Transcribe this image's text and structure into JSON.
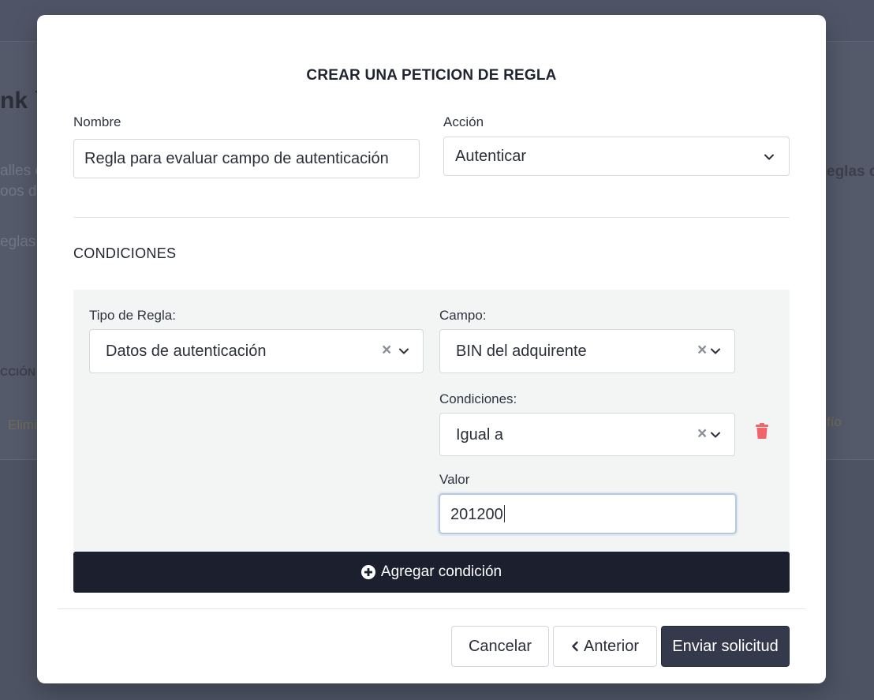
{
  "background": {
    "heading_fragment": "nk `",
    "text_lines": [
      "alles c",
      "oos d",
      "eglas"
    ],
    "table_header": "CCIÓN",
    "delete_link": "Elimi",
    "right_bold": "eglas c",
    "right_link": "fío"
  },
  "modal": {
    "title": "CREAR UNA PETICION DE REGLA",
    "nombre": {
      "label": "Nombre",
      "value": "Regla para evaluar campo de autenticación"
    },
    "accion": {
      "label": "Acción",
      "value": "Autenticar"
    },
    "conditions_section": {
      "title": "CONDICIONES",
      "tipo_regla": {
        "label": "Tipo de Regla:",
        "value": "Datos de autenticación"
      },
      "campo": {
        "label": "Campo:",
        "value": "BIN del adquirente"
      },
      "condiciones": {
        "label": "Condiciones:",
        "value": "Igual a"
      },
      "valor": {
        "label": "Valor",
        "value": "201200"
      },
      "add_button_label": "Agregar condición"
    },
    "footer": {
      "cancel_label": "Cancelar",
      "previous_label": "Anterior",
      "submit_label": "Enviar solicitud"
    }
  },
  "icons": {
    "clear": "clear-icon",
    "chevron": "chevron-down-icon",
    "trash": "trash-icon",
    "plus_circle": "plus-circle-icon",
    "chevron_left": "chevron-left-icon"
  },
  "colors": {
    "primary_dark": "#1b1f2e",
    "submit": "#343a4c",
    "danger": "#f0646c",
    "overlay": "#4d5363"
  }
}
